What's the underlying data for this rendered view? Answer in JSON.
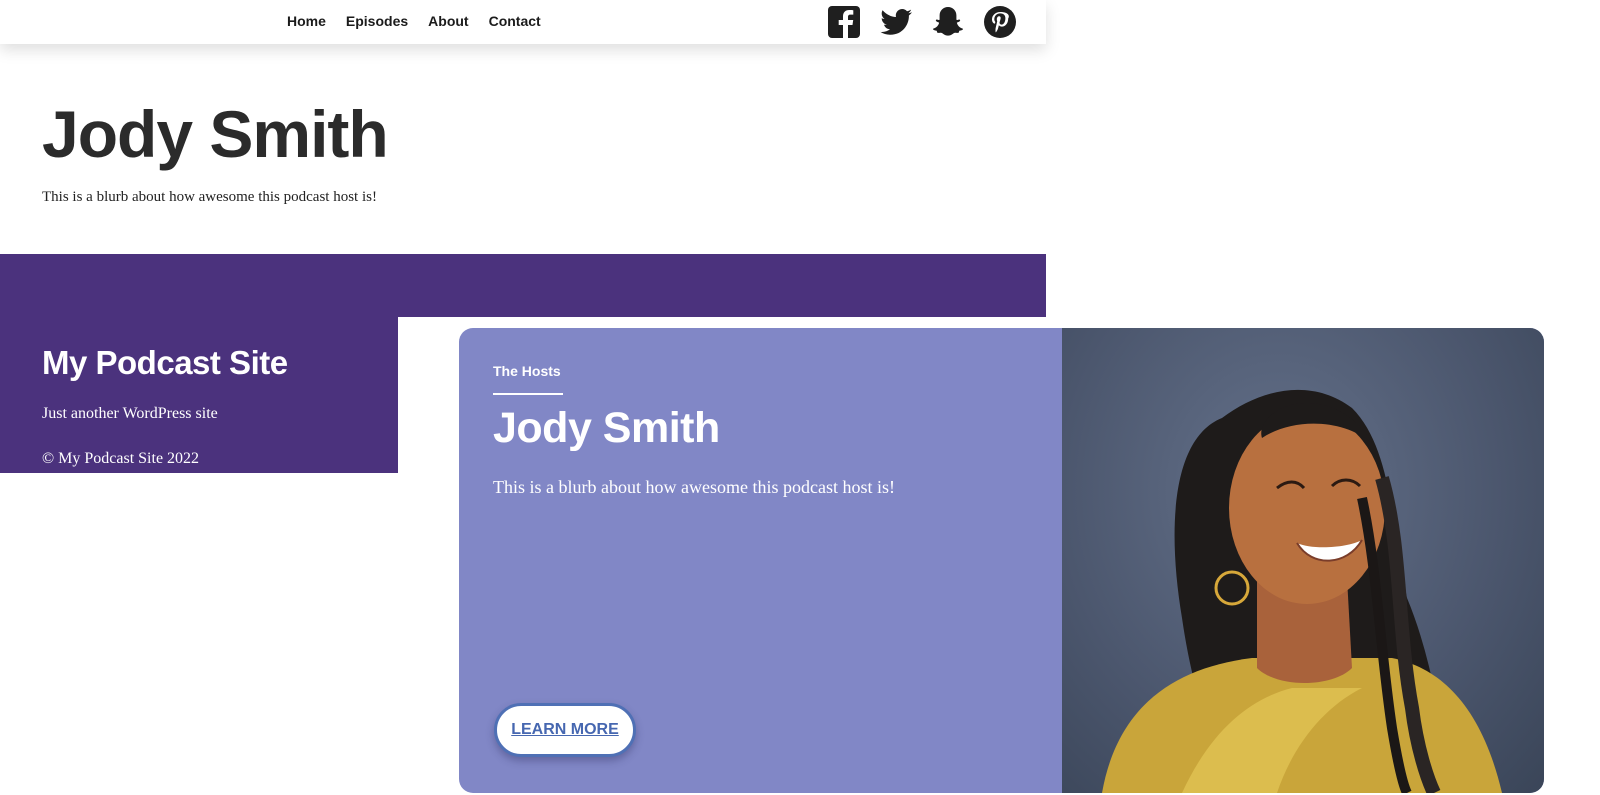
{
  "nav": {
    "items": [
      {
        "label": "Home"
      },
      {
        "label": "Episodes"
      },
      {
        "label": "About"
      },
      {
        "label": "Contact"
      }
    ],
    "social_icons": [
      "facebook-icon",
      "twitter-icon",
      "snapchat-icon",
      "pinterest-icon"
    ]
  },
  "hero": {
    "title": "Jody Smith",
    "blurb": "This is a blurb about how awesome this podcast host is!"
  },
  "footer": {
    "site_title": "My Podcast Site",
    "tagline": "Just another WordPress site",
    "copyright": "© My Podcast Site 2022"
  },
  "card": {
    "kicker": "The Hosts",
    "name": "Jody Smith",
    "blurb": "This is a blurb about how awesome this podcast host is!",
    "button_label": "LEARN MORE"
  },
  "colors": {
    "brand_purple": "#4b327d",
    "card_background": "#8187c6",
    "button_text": "#4667b0"
  }
}
